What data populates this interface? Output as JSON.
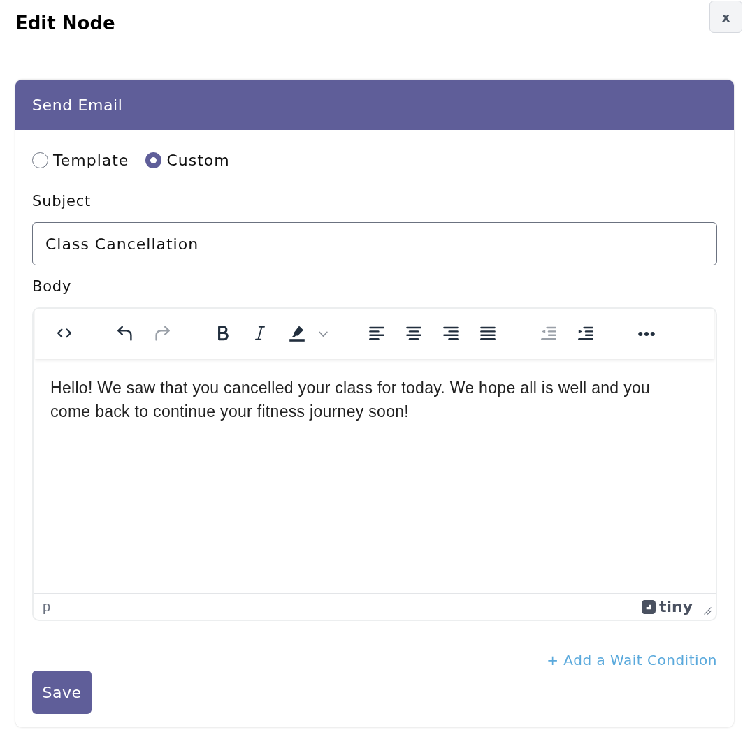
{
  "dialog": {
    "title": "Edit Node",
    "close_label": "x"
  },
  "card": {
    "title": "Send Email"
  },
  "mode_options": [
    {
      "label": "Template",
      "selected": false
    },
    {
      "label": "Custom",
      "selected": true
    }
  ],
  "subject": {
    "label": "Subject",
    "value": "Class Cancellation"
  },
  "body": {
    "label": "Body",
    "toolbar_groups": [
      {
        "items": [
          {
            "kind": "code",
            "disabled": false
          }
        ]
      },
      {
        "items": [
          {
            "kind": "undo",
            "disabled": false
          },
          {
            "kind": "redo",
            "disabled": true
          }
        ]
      },
      {
        "items": [
          {
            "kind": "bold",
            "disabled": false
          },
          {
            "kind": "italic",
            "disabled": false
          },
          {
            "kind": "highlight",
            "disabled": false
          }
        ]
      },
      {
        "items": [
          {
            "kind": "align-left",
            "disabled": false
          },
          {
            "kind": "align-center",
            "disabled": false
          },
          {
            "kind": "align-right",
            "disabled": false
          },
          {
            "kind": "justify",
            "disabled": false
          }
        ]
      },
      {
        "items": [
          {
            "kind": "outdent",
            "disabled": true
          },
          {
            "kind": "indent",
            "disabled": false
          }
        ]
      },
      {
        "items": [
          {
            "kind": "more",
            "disabled": false
          }
        ]
      }
    ],
    "content": "Hello! We saw that you cancelled your class for today. We hope all is well and you come back to continue your fitness journey soon!",
    "element_path": "p",
    "logo_text": "tiny"
  },
  "wait_condition_link": "+ Add a Wait Condition",
  "save_button": "Save"
}
